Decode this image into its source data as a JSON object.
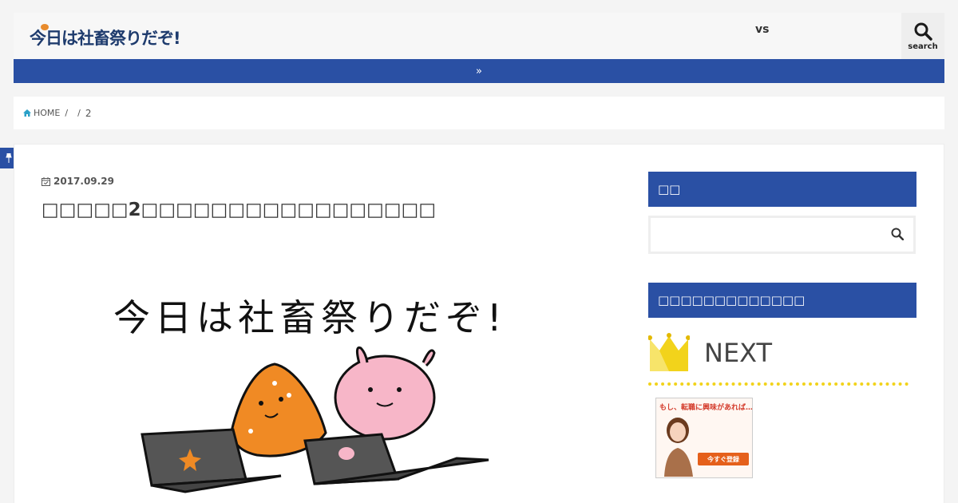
{
  "header": {
    "logo_text": "今日は社畜祭りだぞ!",
    "nav_link": "vs",
    "search_label": "search"
  },
  "navbar": {
    "icon": "double-chevron-right-icon"
  },
  "breadcrumb": {
    "home_label": "HOME",
    "sep1": "/",
    "sep2": "/",
    "current": "2"
  },
  "post": {
    "date": "2017.09.29",
    "title": "□□□□□2□□□□□□□□□□□□□□□□□"
  },
  "eyecatch": {
    "headline": "今日は社畜祭りだぞ!"
  },
  "sidebar": {
    "search_heading": "□□",
    "search_placeholder": "",
    "ranking_heading": "□□□□□□□□□□□□□",
    "ranking_title": "NEXT",
    "ad_headline": "もし、転職に興味があれば…",
    "ad_cta": "今すぐ登録"
  },
  "colors": {
    "accent": "#2a50a4",
    "crown": "#f2d31b",
    "background": "#f4f4f4"
  }
}
